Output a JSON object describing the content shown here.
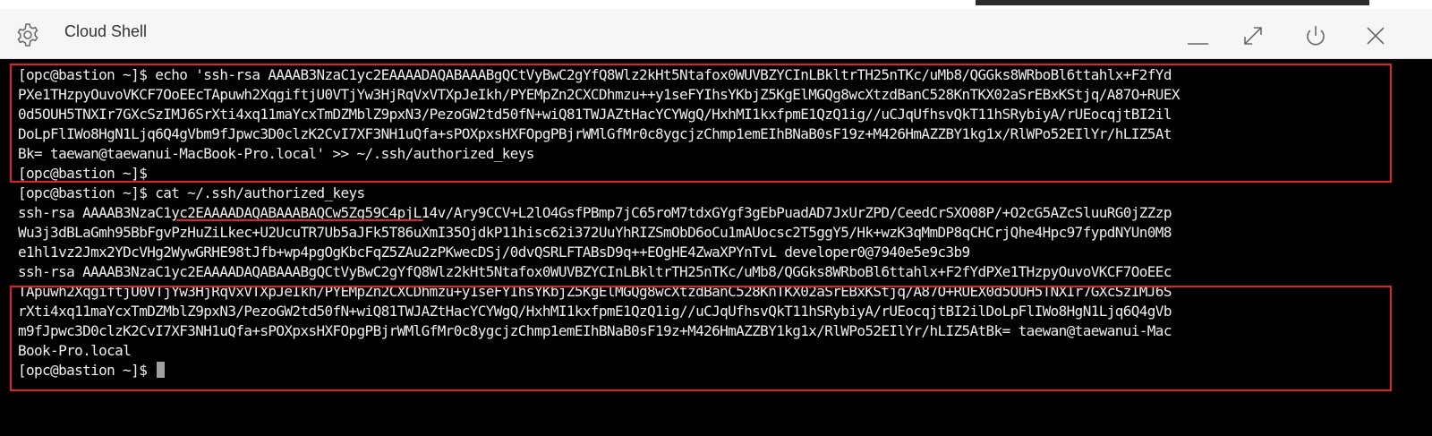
{
  "window": {
    "title": "Cloud Shell"
  },
  "header_icons": [
    "gear-icon",
    "minimize-icon",
    "maximize-icon",
    "restart-icon",
    "close-icon"
  ],
  "colors": {
    "terminal_bg": "#000000",
    "terminal_fg": "#f0f0f0",
    "highlight": "#e0202a"
  },
  "terminal": {
    "lines": [
      "[opc@bastion ~]$ echo 'ssh-rsa AAAAB3NzaC1yc2EAAAADAQABAAABgQCtVyBwC2gYfQ8Wlz2kHt5Ntafox0WUVBZYCInLBkltrTH25nTKc/uMb8/QGGks8WRboBl6ttahlx+F2fYd",
      "PXe1THzpyOuvoVKCF7OoEEcTApuwh2XqgiftjU0VTjYw3HjRqVxVTXpJeIkh/PYEMpZn2CXCDhmzu++y1seFYIhsYKbjZ5KgElMGQg8wcXtzdBanC528KnTKX02aSrEBxKStjq/A87O+RUEX",
      "0d5OUH5TNXIr7GXcSzIMJ6SrXti4xq11maYcxTmDZMblZ9pxN3/PezoGW2td50fN+wiQ81TWJAZtHacYCYWgQ/HxhMI1kxfpmE1QzQ1ig//uCJqUfhsvQkT11hSRybiyA/rUEocqjtBI2il",
      "DoLpFlIWo8HgN1Ljq6Q4gVbm9fJpwc3D0clzK2CvI7XF3NH1uQfa+sPOXpxsHXFOpgPBjrWMlGfMr0c8ygcjzChmp1emEIhBNaB0sF19z+M426HmAZZBY1kg1x/RlWPo52EIlYr/hLIZ5At",
      "Bk= taewan@taewanui-MacBook-Pro.local' >> ~/.ssh/authorized_keys",
      "[opc@bastion ~]$",
      "[opc@bastion ~]$ cat ~/.ssh/authorized_keys",
      "ssh-rsa AAAAB3NzaC1yc2EAAAADAQABAAABAQCw5Zg59C4pjL14v/Ary9CCV+L2lO4GsfPBmp7jC65roM7tdxGYgf3gEbPuadAD7JxUrZPD/CeedCrSXO08P/+O2cG5AZcSluuRG0jZZzp",
      "Wu3j3dBLaGmh95BbFgvPzHuZiLkec+U2UcuTR7Ub5aJFk5T86uXmI35OjdkP11hisc62i372UuYhRIZSmObD6oCu1mAUocsc2T5ggY5/Hk+wzK3qMmDP8qCHCrjQhe4Hpc97fypdNYUn0M8",
      "e1hl1vz2Jmx2YDcVHg2WywGRHE98tJfb+wp4pgOgKbcFqZ5ZAu2zPKwecDSj/0dvQSRLFTABsD9q++EOgHE4ZwaXPYnTvL developer0@7940e5e9c3b9",
      "ssh-rsa AAAAB3NzaC1yc2EAAAADAQABAAABgQCtVyBwC2gYfQ8Wlz2kHt5Ntafox0WUVBZYCInLBkltrTH25nTKc/uMb8/QGGks8WRboBl6ttahlx+F2fYdPXe1THzpyOuvoVKCF7OoEEc",
      "TApuwh2XqgiftjU0VTjYw3HjRqVxVTXpJeIkh/PYEMpZn2CXCDhmzu+y1seFYIhsYKbjZ5KgElMGQg8wcXtzdBanC528KnTKX02aSrEBxKStjq/A87O+RUEX0d5OUH5TNXIr7GXcSzIMJ6S",
      "rXti4xq11maYcxTmDZMblZ9pxN3/PezoGW2td50fN+wiQ81TWJAZtHacYCYWgQ/HxhMI1kxfpmE1QzQ1ig//uCJqUfhsvQkT11hSRybiyA/rUEocqjtBI2ilDoLpFlIWo8HgN1Ljq6Q4gVb",
      "m9fJpwc3D0clzK2CvI7XF3NH1uQfa+sPOXpxsHXFOpgPBjrWMlGfMr0c8ygcjzChmp1emEIhBNaB0sF19z+M426HmAZZBY1kg1x/RlWPo52EIlYr/hLIZ5AtBk= taewan@taewanui-Mac",
      "Book-Pro.local",
      "[opc@bastion ~]$ "
    ]
  }
}
